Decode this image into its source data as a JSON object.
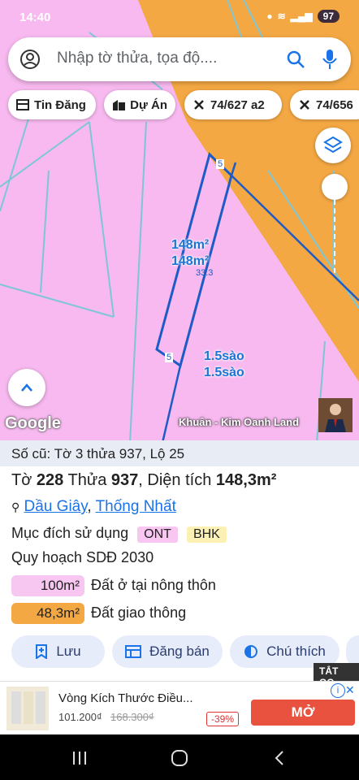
{
  "status": {
    "time": "14:40",
    "battery": "97"
  },
  "search": {
    "placeholder": "Nhập tờ thửa, tọa độ...."
  },
  "chips": [
    "Tin Đăng",
    "Dự Án",
    "74/627 a2",
    "74/656"
  ],
  "map": {
    "parcel_area_label_1": "148m²",
    "parcel_area_label_2": "148m²",
    "sao_label_1": "1.5sào",
    "sao_label_2": "1.5sào",
    "edge_label_top": "5",
    "edge_label_bottom": "5",
    "edge_label_side": "33.3",
    "google": "Google",
    "owner": "Khuân - Kim Oanh Land",
    "colors": {
      "residential": "#f7b9ef",
      "transport": "#f4a844",
      "outline": "#1e5bc6"
    }
  },
  "panel": {
    "old_info": "Số cũ: Tờ 3 thửa 937, Lộ 25",
    "sheet_prefix": "Tờ",
    "sheet": "228",
    "plot_prefix": "Thửa",
    "plot": "937",
    "area_prefix": "Diện tích",
    "area": "148,3m²",
    "district": "Dầu Giây",
    "ward": "Thống Nhất",
    "purpose_label": "Mục đích sử dụng",
    "purpose_tags": [
      "ONT",
      "BHK"
    ],
    "planning": "Quy hoạch SDĐ 2030",
    "legend": [
      {
        "area": "100m²",
        "label": "Đất ở tại nông thôn",
        "color": "#f7c6f1"
      },
      {
        "area": "48,3m²",
        "label": "Đất giao thông",
        "color": "#f4a844"
      }
    ],
    "buttons": {
      "save": "Lưu",
      "post": "Đăng bán",
      "legend": "Chú thích"
    }
  },
  "ad": {
    "title": "Vòng Kích Thước Điều...",
    "price": "101.200₫",
    "old_price": "168.300₫",
    "discount": "-39%",
    "cta": "MỞ",
    "close": "TẮT QC"
  }
}
